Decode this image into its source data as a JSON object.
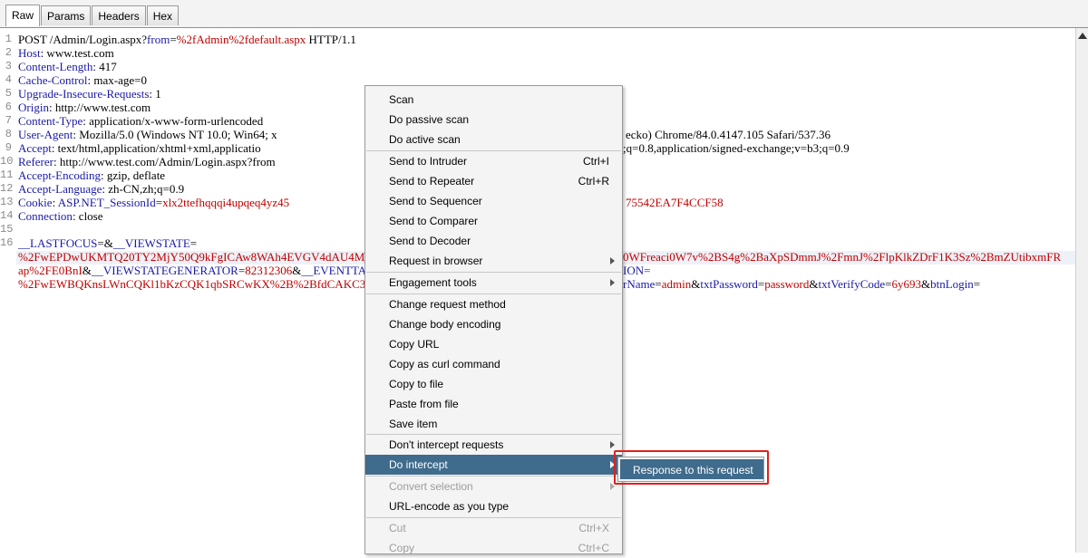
{
  "tabs": [
    "Raw",
    "Params",
    "Headers",
    "Hex"
  ],
  "request": {
    "l1_method": "POST /Admin/Login.aspx?",
    "l1_from_key": "from",
    "l1_eq": "=",
    "l1_from_val": "%2fAdmin%2fdefault.aspx",
    "l1_proto": " HTTP/1.1",
    "l2_key": "Host",
    "l2_val": ": www.test.com",
    "l3_key": "Content-Length",
    "l3_val": ": 417",
    "l4_key": "Cache-Control",
    "l4_val": ": max-age=0",
    "l5_key": "Upgrade-Insecure-Requests",
    "l5_val": ": 1",
    "l6_key": "Origin",
    "l6_val": ": http://www.test.com",
    "l7_key": "Content-Type",
    "l7_val": ": application/x-www-form-urlencoded",
    "l8_key": "User-Agent",
    "l8_val": ": Mozilla/5.0 (Windows NT 10.0; Win64; x",
    "l8_tail": "ecko) Chrome/84.0.4147.105 Safari/537.36",
    "l9_key": "Accept",
    "l9_val": ": text/html,application/xhtml+xml,applicatio",
    "l9_tail": ";q=0.8,application/signed-exchange;v=b3;q=0.9",
    "l10_key": "Referer",
    "l10_val": ": http://www.test.com/Admin/Login.aspx?from",
    "l11_key": "Accept-Encoding",
    "l11_val": ": gzip, deflate",
    "l12_key": "Accept-Language",
    "l12_val": ": zh-CN,zh;q=0.9",
    "l13_key": "Cookie",
    "l13_sep": ": ",
    "l13_ck": "ASP.NET_SessionId",
    "l13_eq": "=",
    "l13_cv": "xlx2ttefhqqqi4upqeq4yz45",
    "l13_tail": "75542EA7F4CCF58",
    "l14_key": "Connection",
    "l14_val": ": close",
    "b1_k1": "__LASTFOCUS",
    "b1_mid": "=&",
    "b1_k2": "__VIEWSTATE",
    "b1_eq": "=",
    "b2_val": "%2FwEPDwUKMTQ20TY2MjY50Q9kFgICAw8WAh4EVGV4dAU4MjAy",
    "b2_tail": "0WFreaci0W7v%2BS4g%2BaXpSDmmJ%2FmnJ%2FlpKlkZDrF1K3Sz%2BmZUtibxmFR",
    "b3_val": "ap%2FE0BnI",
    "b3_amp": "&",
    "b3_k": "__VIEWSTATEGENERATOR",
    "b3_eq": "=",
    "b3_v": "82312306",
    "b3_amp2": "&",
    "b3_k2": "__EVENTTA",
    "b3_tail": "ION=",
    "b4_val": "%2FwEWBQKnsLWnCQKl1bKzCQK1qbSRCwKX%2B%2BfdCAKC3IeG",
    "b4_t1": "rName",
    "b4_e1": "=",
    "b4_v1": "admin",
    "b4_a1": "&",
    "b4_t2": "txtPassword",
    "b4_e2": "=",
    "b4_v2": "password",
    "b4_a2": "&",
    "b4_t3": "txtVerifyCode",
    "b4_e3": "=",
    "b4_v3": "6y693",
    "b4_a3": "&",
    "b4_t4": "btnLogin",
    "b4_e4": "="
  },
  "line_numbers": [
    "1",
    "2",
    "3",
    "4",
    "5",
    "6",
    "7",
    "8",
    "9",
    "10",
    "11",
    "12",
    "13",
    "14",
    "15",
    "16"
  ],
  "context_menu": {
    "scan": "Scan",
    "passive_scan": "Do passive scan",
    "active_scan": "Do active scan",
    "send_intruder": "Send to Intruder",
    "send_intruder_sc": "Ctrl+I",
    "send_repeater": "Send to Repeater",
    "send_repeater_sc": "Ctrl+R",
    "send_sequencer": "Send to Sequencer",
    "send_comparer": "Send to Comparer",
    "send_decoder": "Send to Decoder",
    "request_browser": "Request in browser",
    "engagement_tools": "Engagement tools",
    "change_method": "Change request method",
    "change_encoding": "Change body encoding",
    "copy_url": "Copy URL",
    "copy_curl": "Copy as curl command",
    "copy_file": "Copy to file",
    "paste_file": "Paste from file",
    "save_item": "Save item",
    "dont_intercept": "Don't intercept requests",
    "do_intercept": "Do intercept",
    "convert_selection": "Convert selection",
    "url_encode": "URL-encode as you type",
    "cut": "Cut",
    "cut_sc": "Ctrl+X",
    "copy": "Copy",
    "copy_sc": "Ctrl+C"
  },
  "submenu": {
    "response": "Response to this request"
  },
  "colors": {
    "selection": "#3f6b8c",
    "callout": "#e0201c",
    "param_red": "#c00000",
    "key_blue": "#1a1aa6"
  }
}
